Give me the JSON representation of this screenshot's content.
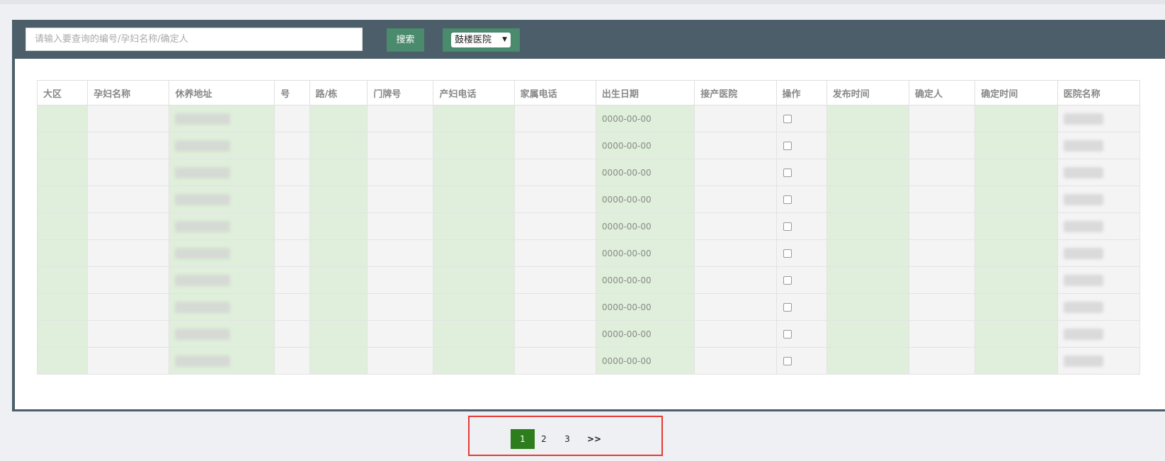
{
  "search": {
    "placeholder": "请输入要查询的编号/孕妇名称/确定人",
    "button_label": "搜索",
    "hospital_selected": "鼓楼医院"
  },
  "table": {
    "headers": [
      "大区",
      "孕妇名称",
      "休养地址",
      "号",
      "路/栋",
      "门牌号",
      "产妇电话",
      "家属电话",
      "出生日期",
      "接产医院",
      "操作",
      "发布时间",
      "确定人",
      "确定时间",
      "医院名称"
    ],
    "rows": [
      {
        "birth_date": "0000-00-00"
      },
      {
        "birth_date": "0000-00-00"
      },
      {
        "birth_date": "0000-00-00"
      },
      {
        "birth_date": "0000-00-00"
      },
      {
        "birth_date": "0000-00-00"
      },
      {
        "birth_date": "0000-00-00"
      },
      {
        "birth_date": "0000-00-00"
      },
      {
        "birth_date": "0000-00-00"
      },
      {
        "birth_date": "0000-00-00"
      },
      {
        "birth_date": "0000-00-00"
      }
    ]
  },
  "pagination": {
    "pages": [
      "1",
      "2",
      "3"
    ],
    "current": "1",
    "next_label": ">>"
  },
  "colors": {
    "panel": "#4b5e69",
    "button": "#4a8a6d",
    "highlight_column": "#dfefdb",
    "active_page": "#2e7d1c",
    "annotation_frame": "#e53935"
  }
}
